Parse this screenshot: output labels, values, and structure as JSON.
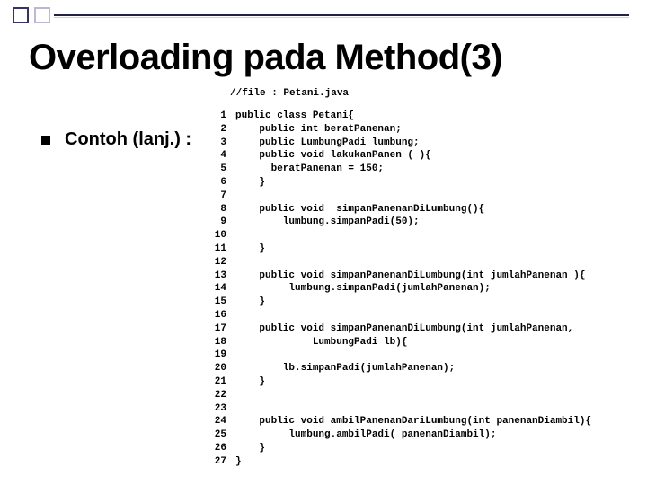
{
  "title": "Overloading pada Method(3)",
  "file_comment": "//file : Petani.java",
  "subtitle": "Contoh (lanj.) :",
  "code": {
    "lines": [
      {
        "n": "1",
        "t": "public class Petani{"
      },
      {
        "n": "2",
        "t": "    public int beratPanenan;"
      },
      {
        "n": "3",
        "t": "    public LumbungPadi lumbung;"
      },
      {
        "n": "4",
        "t": "    public void lakukanPanen ( ){"
      },
      {
        "n": "5",
        "t": "      beratPanenan = 150;"
      },
      {
        "n": "6",
        "t": "    }"
      },
      {
        "n": "7",
        "t": ""
      },
      {
        "n": "8",
        "t": "    public void  simpanPanenanDiLumbung(){"
      },
      {
        "n": "9",
        "t": "        lumbung.simpanPadi(50);"
      },
      {
        "n": "10",
        "t": ""
      },
      {
        "n": "11",
        "t": "    }"
      },
      {
        "n": "12",
        "t": ""
      },
      {
        "n": "13",
        "t": "    public void simpanPanenanDiLumbung(int jumlahPanenan ){"
      },
      {
        "n": "14",
        "t": "         lumbung.simpanPadi(jumlahPanenan);"
      },
      {
        "n": "15",
        "t": "    }"
      },
      {
        "n": "16",
        "t": ""
      },
      {
        "n": "17",
        "t": "    public void simpanPanenanDiLumbung(int jumlahPanenan,"
      },
      {
        "n": "18",
        "t": "             LumbungPadi lb){"
      },
      {
        "n": "19",
        "t": ""
      },
      {
        "n": "20",
        "t": "        lb.simpanPadi(jumlahPanenan);"
      },
      {
        "n": "21",
        "t": "    }"
      },
      {
        "n": "22",
        "t": ""
      },
      {
        "n": "23",
        "t": ""
      },
      {
        "n": "24",
        "t": "    public void ambilPanenanDariLumbung(int panenanDiambil){"
      },
      {
        "n": "25",
        "t": "         lumbung.ambilPadi( panenanDiambil);"
      },
      {
        "n": "26",
        "t": "    }"
      },
      {
        "n": "27",
        "t": "}"
      }
    ]
  }
}
